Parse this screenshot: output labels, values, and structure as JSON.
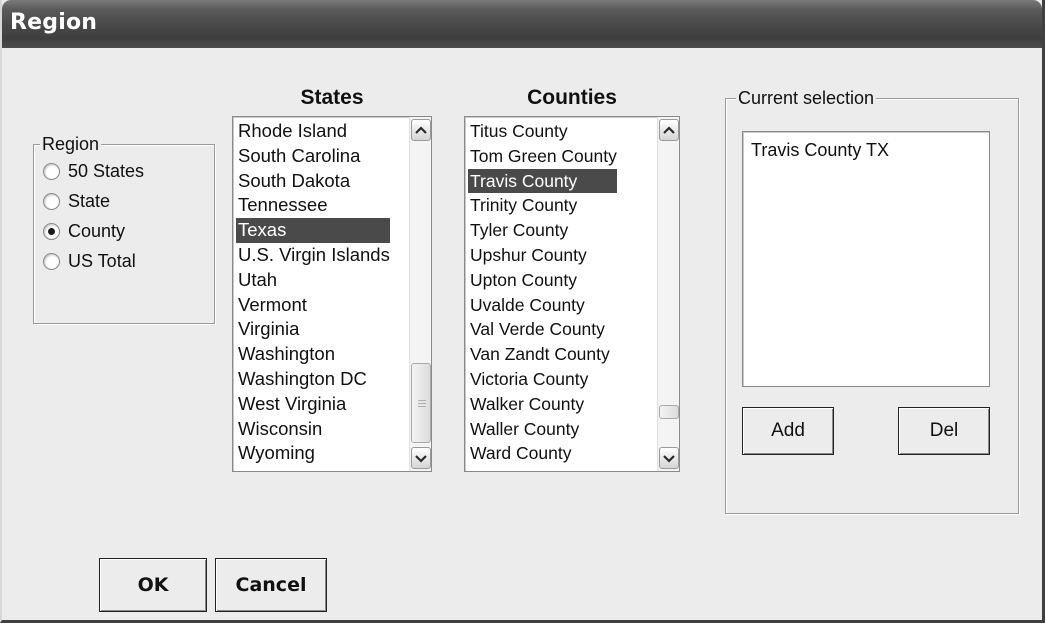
{
  "window": {
    "title": "Region"
  },
  "region_group": {
    "label": "Region",
    "options": [
      {
        "label": "50 States",
        "checked": false
      },
      {
        "label": "State",
        "checked": false
      },
      {
        "label": "County",
        "checked": true
      },
      {
        "label": "US Total",
        "checked": false
      }
    ]
  },
  "states": {
    "heading": "States",
    "items": [
      "Rhode Island",
      "South Carolina",
      "South Dakota",
      "Tennessee",
      "Texas",
      "U.S. Virgin Islands",
      "Utah",
      "Vermont",
      "Virginia",
      "Washington",
      "Washington DC",
      "West Virginia",
      "Wisconsin",
      "Wyoming"
    ],
    "selected": "Texas"
  },
  "counties": {
    "heading": "Counties",
    "items": [
      "Titus County",
      "Tom Green County",
      "Travis County",
      "Trinity County",
      "Tyler County",
      "Upshur County",
      "Upton County",
      "Uvalde County",
      "Val Verde County",
      "Van Zandt County",
      "Victoria County",
      "Walker County",
      "Waller County",
      "Ward County"
    ],
    "selected": "Travis County"
  },
  "current_selection": {
    "label": "Current selection",
    "items": [
      "Travis County TX"
    ],
    "add_label": "Add",
    "del_label": "Del"
  },
  "buttons": {
    "ok_label": "OK",
    "cancel_label": "Cancel"
  },
  "icons": {
    "scroll_up": "chevron-up-icon",
    "scroll_down": "chevron-down-icon"
  },
  "colors": {
    "selection": "#4a4a4a",
    "titlebar": "#4a4a4a",
    "face": "#ececec"
  }
}
